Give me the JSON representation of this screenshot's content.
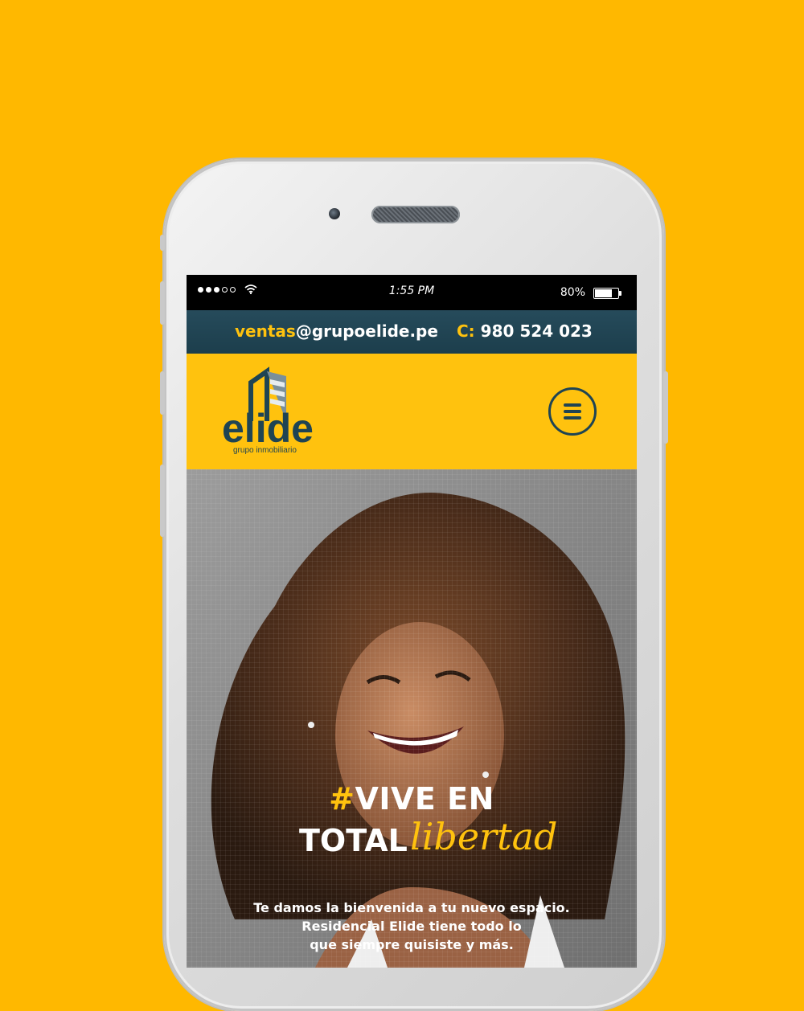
{
  "status_bar": {
    "time": "1:55 PM",
    "battery_percent": "80%",
    "battery_level": 0.8,
    "signal_icon": "signal-dots-icon",
    "wifi_icon": "wifi-icon"
  },
  "contact_bar": {
    "email_prefix": "ventas",
    "email_domain": "@grupoelide.pe",
    "phone_prefix": "C:",
    "phone_number": "980 524 023"
  },
  "header": {
    "logo_text": "elide",
    "logo_tagline": "grupo inmobiliario",
    "menu_icon": "hamburger-menu-icon"
  },
  "hero": {
    "hashtag": "#",
    "headline_line1": "VIVE EN",
    "headline_line2": "TOTAL",
    "headline_accent": "libertad",
    "copy_line1": "Te damos la bienvenida a tu nuevo espacio.",
    "copy_line2": "Residencial Elide tiene todo lo",
    "copy_line3": "que siempre quisiste y más."
  },
  "colors": {
    "background": "#FFB800",
    "brand_yellow": "#FFC20E",
    "brand_navy": "#1F4453"
  }
}
